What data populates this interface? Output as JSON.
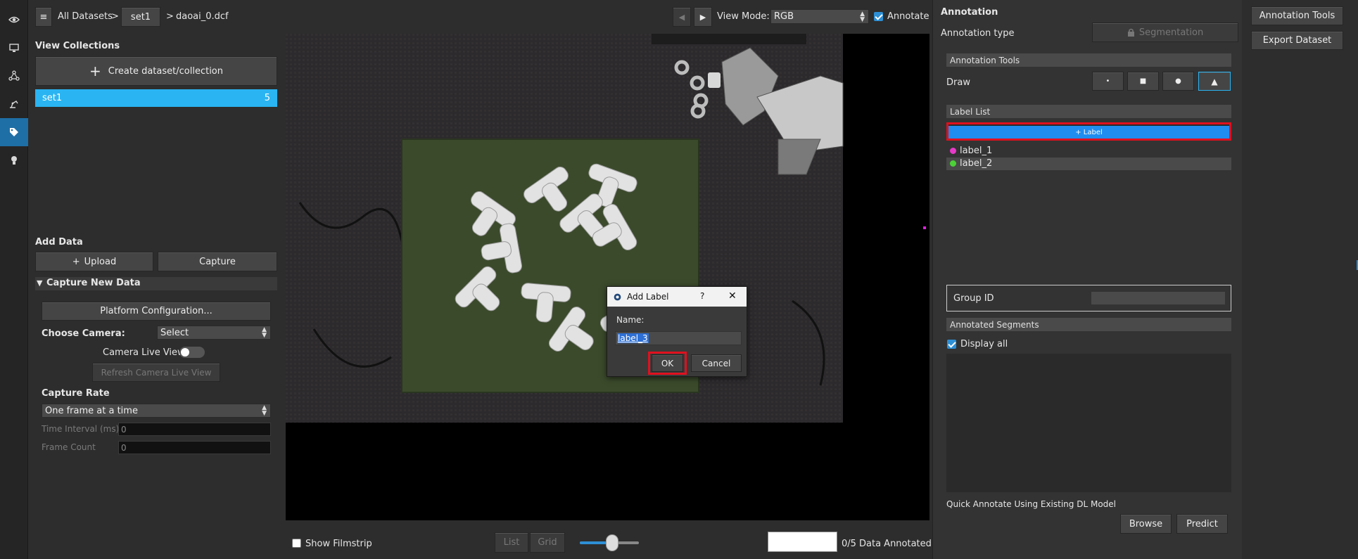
{
  "rail": {
    "icons": [
      "eye-icon",
      "monitor-icon",
      "network-icon",
      "robot-arm-icon",
      "tag-icon",
      "lightbulb-icon"
    ],
    "active_index": 4
  },
  "header": {
    "menu_glyph": "≡",
    "breadcrumb_root": "All Datasets",
    "breadcrumb_sep1": ">",
    "breadcrumb_set": "set1",
    "breadcrumb_sep2": ">",
    "breadcrumb_file": "daoai_0.dcf",
    "prev_glyph": "◀",
    "next_glyph": "▶",
    "view_mode_label": "View Mode:",
    "view_mode_value": "RGB",
    "annotate_label": "Annotate",
    "annotate_checked": true
  },
  "left": {
    "view_collections_title": "View Collections",
    "create_button_plus": "+",
    "create_button_label": "Create dataset/collection",
    "collections": [
      {
        "name": "set1",
        "count": "5",
        "selected": true
      }
    ],
    "add_data_title": "Add Data",
    "upload_plus": "+",
    "upload_label": "Upload",
    "capture_label": "Capture",
    "capture_section_title": "Capture New Data",
    "capture_section_arrow": "▼",
    "platform_config_label": "Platform Configuration...",
    "choose_camera_label": "Choose Camera:",
    "choose_camera_value": "Select",
    "camera_live_view_label": "Camera Live View",
    "camera_live_view_on": false,
    "refresh_live_view_label": "Refresh Camera Live View",
    "capture_rate_title": "Capture Rate",
    "capture_rate_value": "One frame at a time",
    "time_interval_label": "Time Interval (ms)",
    "time_interval_value": "0",
    "frame_count_label": "Frame Count",
    "frame_count_value": "0"
  },
  "bottom": {
    "show_filmstrip_label": "Show Filmstrip",
    "show_filmstrip_checked": false,
    "list_label": "List",
    "grid_label": "Grid",
    "annotated_count": "0/5",
    "annotated_label": "Data Annotated",
    "zoom_slider_fraction": 0.55
  },
  "dialog": {
    "title": "Add Label",
    "help_glyph": "?",
    "close_glyph": "✕",
    "name_label": "Name:",
    "name_value": "label_3",
    "ok_label": "OK",
    "cancel_label": "Cancel"
  },
  "annotation": {
    "title": "Annotation",
    "type_label": "Annotation type",
    "type_value": "Segmentation",
    "tools_header": "Annotation Tools",
    "draw_label": "Draw",
    "draw_tools": [
      "point-tool-icon",
      "square-tool-icon",
      "circle-tool-icon",
      "polygon-tool-icon"
    ],
    "draw_tool_glyphs": [
      "•",
      "■",
      "●",
      "▲"
    ],
    "selected_tool_index": 3,
    "label_list_header": "Label List",
    "add_label_button": "+ Label",
    "labels": [
      {
        "name": "label_1",
        "color": "#e83ac8"
      },
      {
        "name": "label_2",
        "color": "#4cd137"
      }
    ],
    "group_id_label": "Group ID",
    "group_id_value": "",
    "segments_header": "Annotated Segments",
    "display_all_label": "Display all",
    "display_all_checked": true,
    "quick_annotate_label": "Quick Annotate Using Existing DL Model",
    "browse_label": "Browse",
    "predict_label": "Predict"
  },
  "far_right": {
    "annotation_tools_button": "Annotation Tools",
    "export_dataset_button": "Export Dataset"
  },
  "colors": {
    "accent_blue": "#2ab4f2",
    "highlight_red": "#e0101e",
    "checkbox_blue": "#2d8fd5"
  }
}
